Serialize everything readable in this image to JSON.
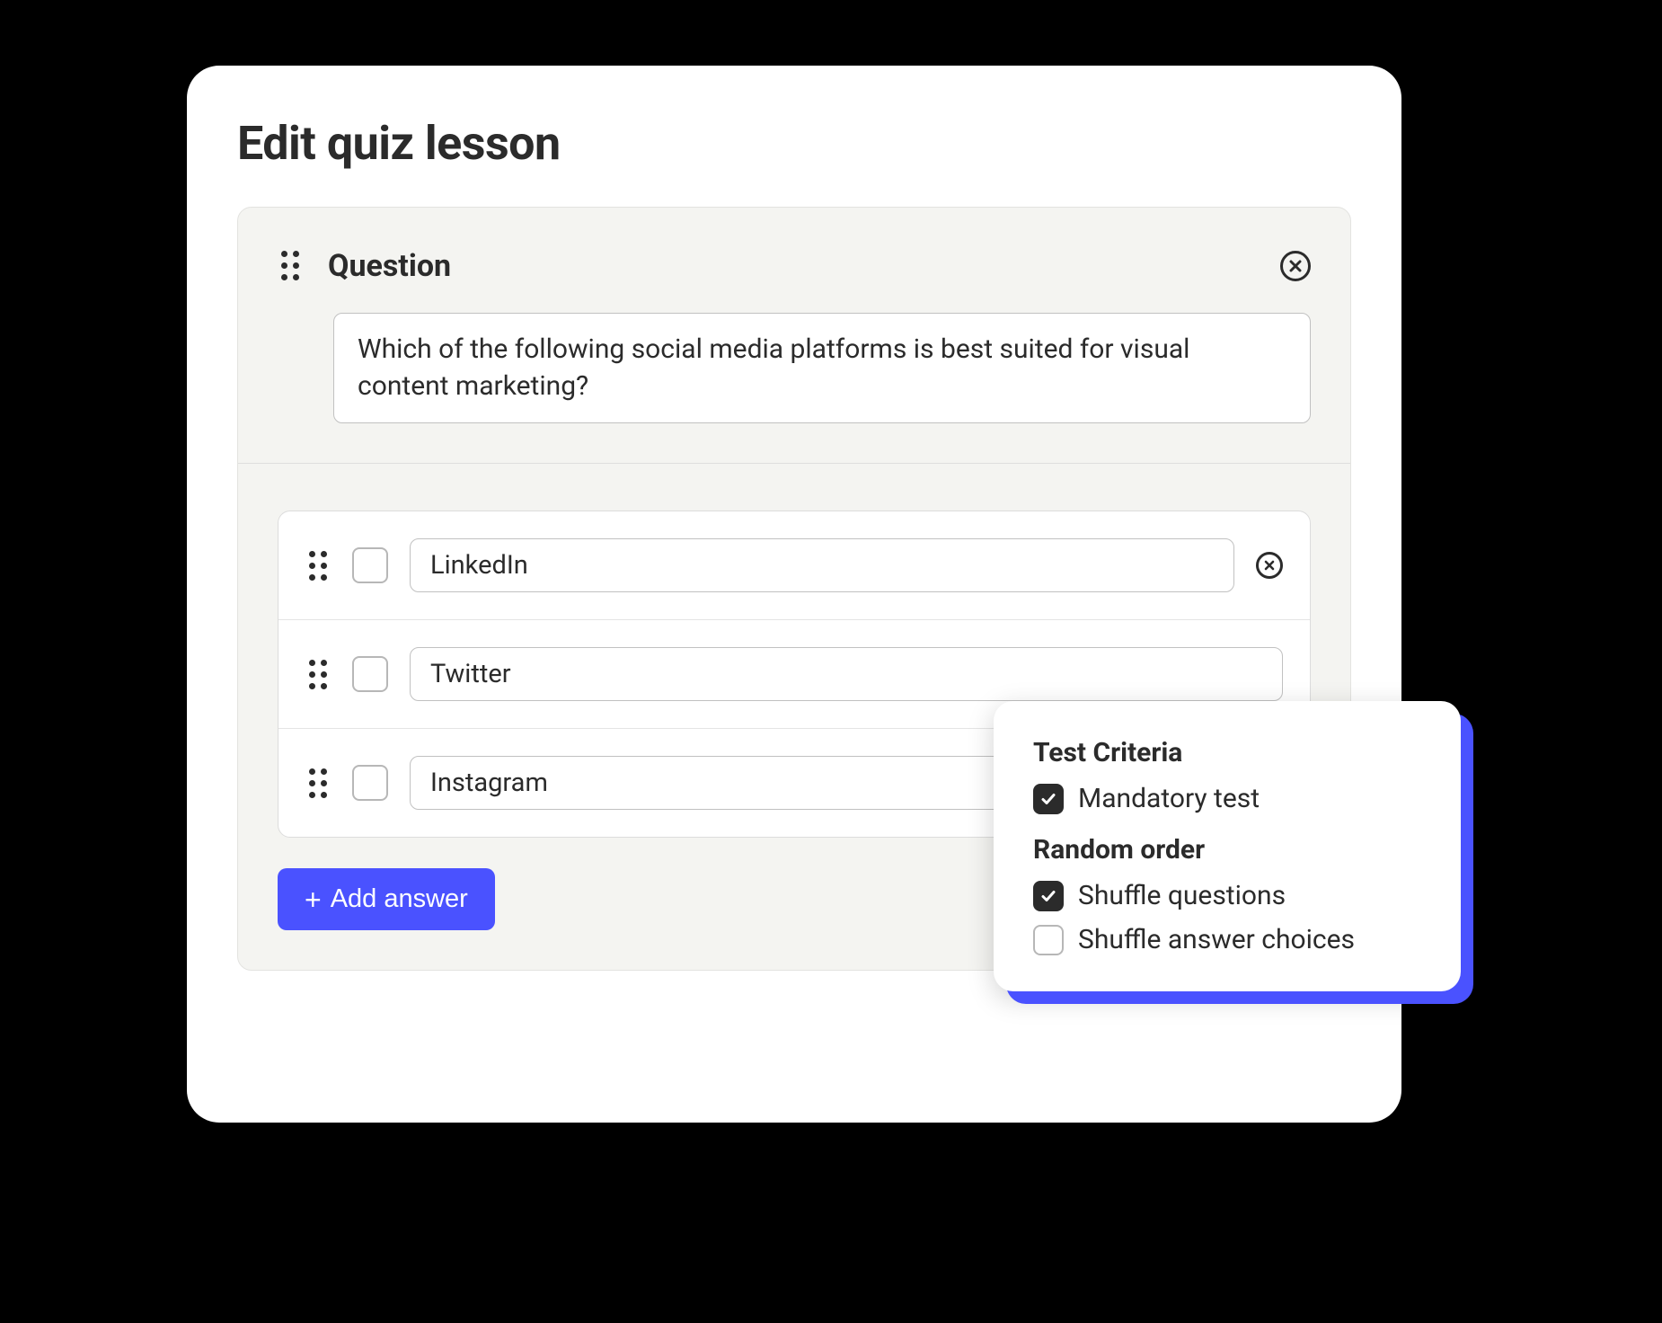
{
  "title": "Edit quiz lesson",
  "question": {
    "label": "Question",
    "text": "Which of the following social media platforms is best suited for visual content marketing?"
  },
  "answers": [
    {
      "text": "LinkedIn",
      "checked": false,
      "show_close": true
    },
    {
      "text": "Twitter",
      "checked": false,
      "show_close": false
    },
    {
      "text": "Instagram",
      "checked": false,
      "show_close": false
    }
  ],
  "add_answer_label": "Add answer",
  "criteria": {
    "section1_title": "Test Criteria",
    "mandatory": {
      "label": "Mandatory test",
      "checked": true
    },
    "section2_title": "Random order",
    "shuffle_questions": {
      "label": "Shuffle questions",
      "checked": true
    },
    "shuffle_answers": {
      "label": "Shuffle answer choices",
      "checked": false
    }
  },
  "colors": {
    "accent": "#4a52ff"
  }
}
